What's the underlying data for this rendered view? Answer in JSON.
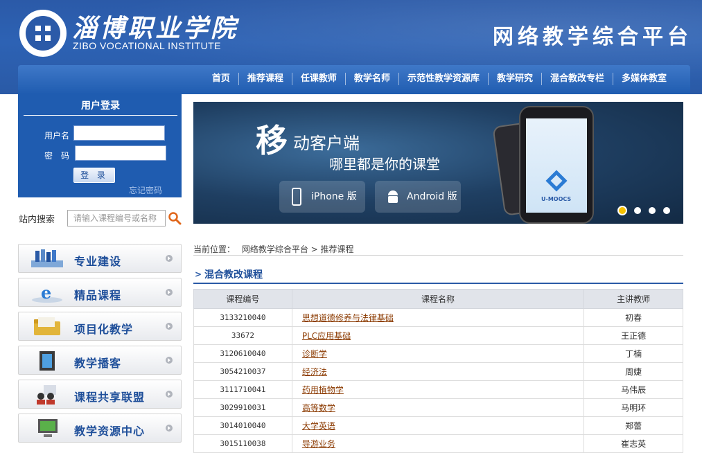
{
  "header": {
    "school_cn": "淄博职业学院",
    "school_en": "ZIBO VOCATIONAL INSTITUTE",
    "platform": "网络教学综合平台"
  },
  "nav": {
    "items": [
      "首页",
      "推荐课程",
      "任课教师",
      "教学名师",
      "示范性教学资源库",
      "教学研究",
      "混合教改专栏",
      "多媒体教室"
    ]
  },
  "login": {
    "title": "用户登录",
    "username_label": "用户名",
    "password_label": "密　码",
    "button": "登 录",
    "forgot": "忘记密码"
  },
  "search": {
    "label": "站内搜索",
    "placeholder": "请输入课程编号或名称"
  },
  "side_menu": [
    "专业建设",
    "精品课程",
    "项目化教学",
    "教学播客",
    "课程共享联盟",
    "教学资源中心"
  ],
  "banner": {
    "big": "移",
    "line1": "动客户端",
    "line2": "哪里都是你的课堂",
    "iphone": "iPhone 版",
    "android": "Android 版",
    "brand": "U-MOOCS"
  },
  "breadcrumb": {
    "prefix": "当前位置：",
    "path": "网络教学综合平台 > 推荐课程"
  },
  "section": {
    "title": "混合教改课程"
  },
  "table": {
    "headers": [
      "课程编号",
      "课程名称",
      "主讲教师"
    ],
    "rows": [
      [
        "3133210040",
        "思想道德修养与法律基础",
        "初春"
      ],
      [
        "33672",
        "PLC应用基础",
        "王正德"
      ],
      [
        "3120610040",
        "诊断学",
        "丁楠"
      ],
      [
        "3054210037",
        "经济法",
        "周婕"
      ],
      [
        "3111710041",
        "药用植物学",
        "马伟辰"
      ],
      [
        "3029910031",
        "高等数学",
        "马明环"
      ],
      [
        "3014010040",
        "大学英语",
        "郑蕾"
      ],
      [
        "3015110038",
        "导游业务",
        "崔志英"
      ]
    ]
  },
  "colors": {
    "header_blue": "#2b5aa8",
    "nav_blue": "#1f5cb0",
    "link_brown": "#8b3a00",
    "accent_yellow": "#f6c200"
  }
}
